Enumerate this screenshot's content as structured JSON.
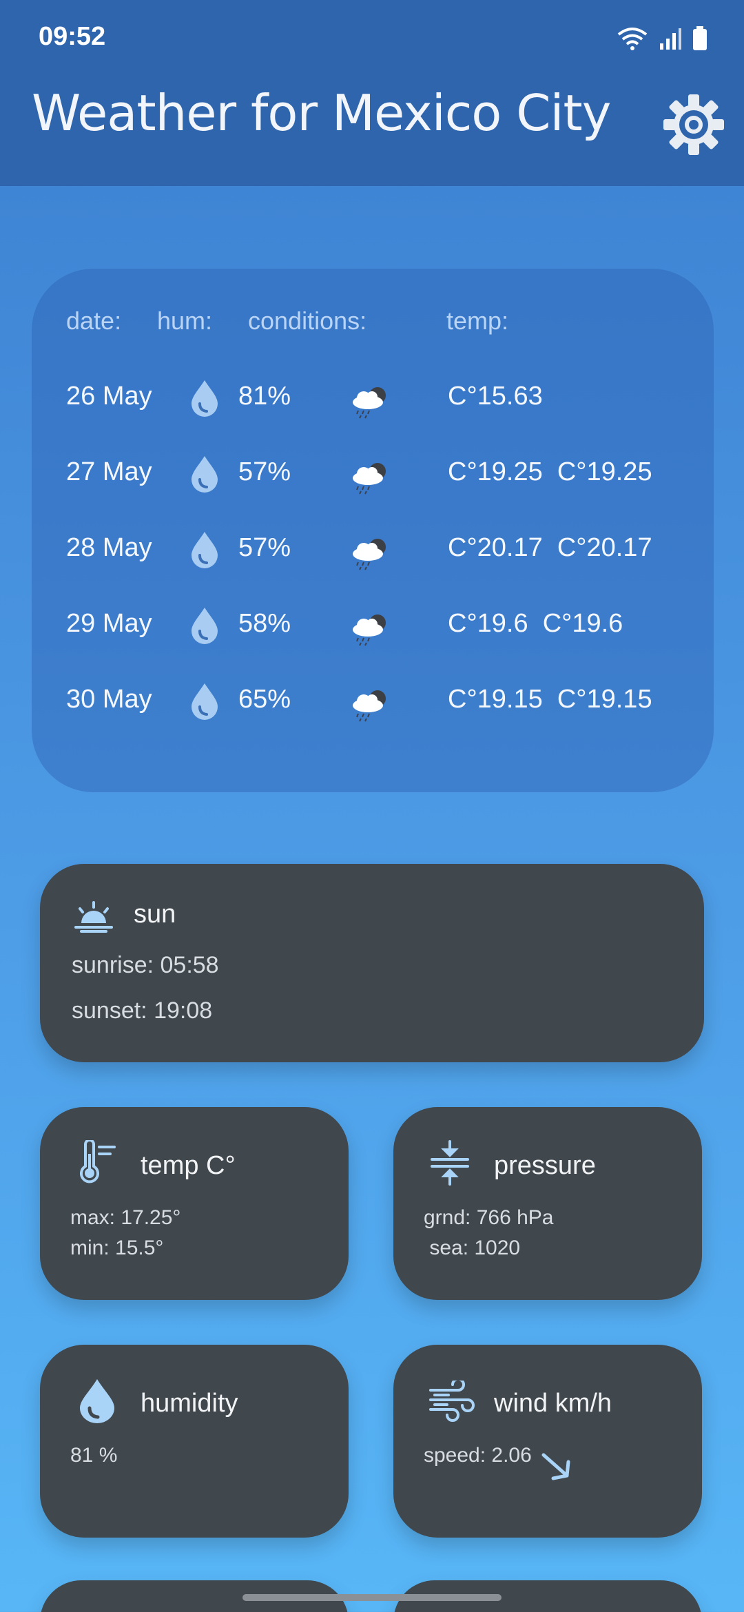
{
  "status_bar": {
    "time": "09:52"
  },
  "app_bar": {
    "title": "Weather for Mexico City",
    "settings_icon": "gear-icon"
  },
  "forecast": {
    "headers": {
      "date": "date:",
      "hum": "hum:",
      "conditions": "conditions:",
      "temp": "temp:"
    },
    "rows": [
      {
        "date": "26 May",
        "humidity": "81%",
        "condition_icon": "cloud-rain-icon",
        "temp": "C°15.63"
      },
      {
        "date": "27 May",
        "humidity": "57%",
        "condition_icon": "cloud-rain-icon",
        "temp": "C°19.25  C°19.25"
      },
      {
        "date": "28 May",
        "humidity": "57%",
        "condition_icon": "cloud-rain-icon",
        "temp": "C°20.17  C°20.17"
      },
      {
        "date": "29 May",
        "humidity": "58%",
        "condition_icon": "cloud-rain-icon",
        "temp": "C°19.6  C°19.6"
      },
      {
        "date": "30 May",
        "humidity": "65%",
        "condition_icon": "cloud-rain-icon",
        "temp": "C°19.15  C°19.15"
      }
    ]
  },
  "sun": {
    "title": "sun",
    "sunrise": "sunrise: 05:58",
    "sunset": "sunset: 19:08"
  },
  "temp_card": {
    "title": "temp C°",
    "max": "max: 17.25°",
    "min": "min: 15.5°"
  },
  "pressure_card": {
    "title": "pressure",
    "grnd": "grnd: 766 hPa",
    "sea": " sea: 1020"
  },
  "humidity_card": {
    "title": "humidity",
    "value": "81 %"
  },
  "wind_card": {
    "title": "wind km/h",
    "speed": "speed: 2.06"
  },
  "colors": {
    "header_bg": "#2f65ad",
    "card_dark": "#40474d",
    "accent_light_blue": "#a9d4f7"
  }
}
